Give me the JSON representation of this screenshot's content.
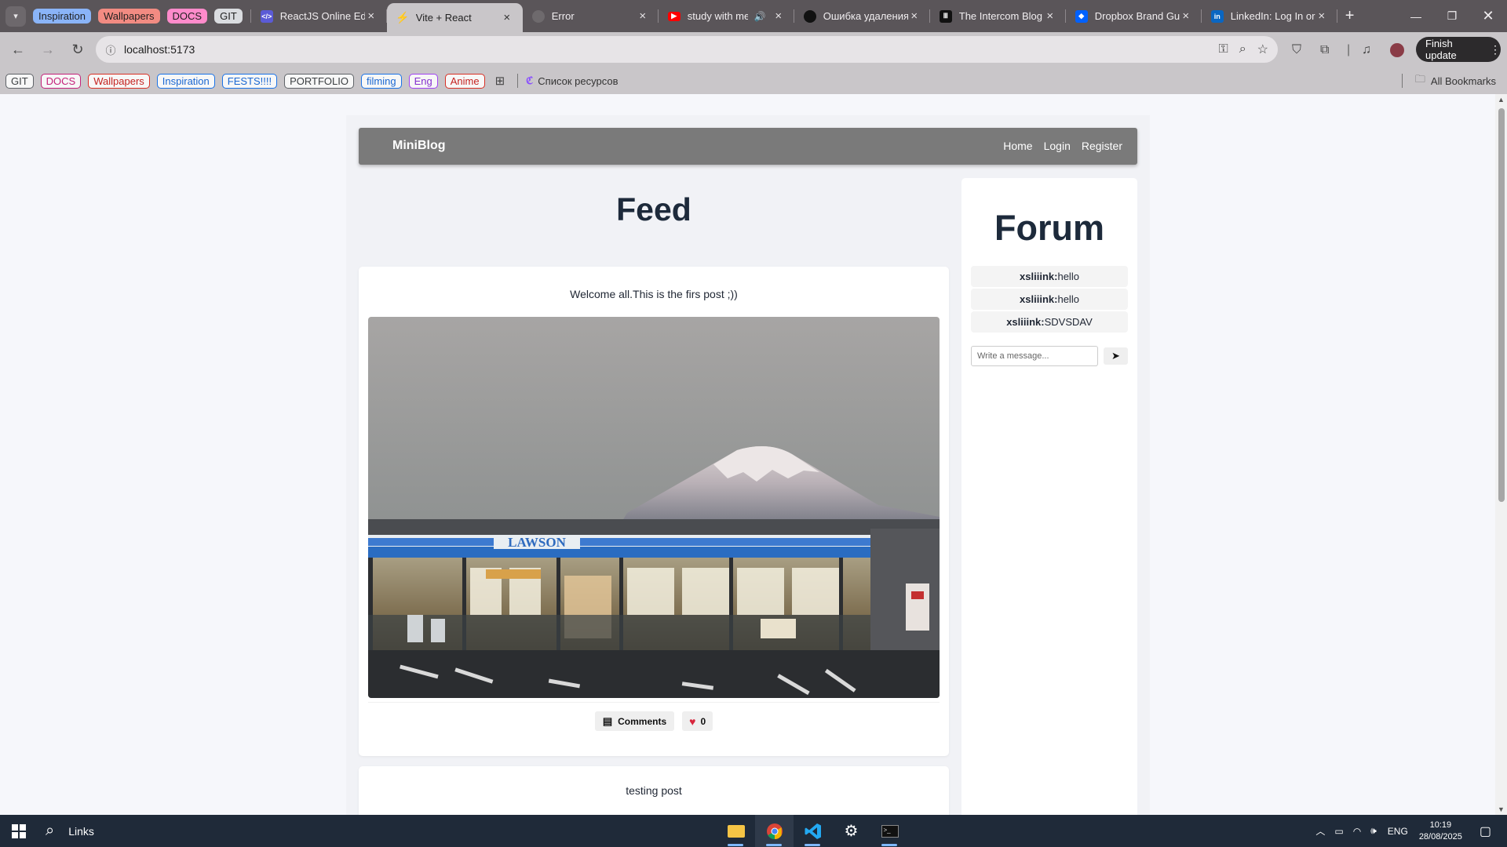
{
  "browser": {
    "tab_groups": [
      {
        "label": "Inspiration",
        "color": "#8ab4f8"
      },
      {
        "label": "Wallpapers",
        "color": "#f28b82"
      },
      {
        "label": "DOCS",
        "color": "#ff8bcb"
      },
      {
        "label": "GIT",
        "color": "#dadce0"
      }
    ],
    "tabs": [
      {
        "title": "ReactJS Online Editor",
        "icon": "code-icon",
        "color": "#5b5bd6",
        "active": false
      },
      {
        "title": "Vite + React",
        "icon": "vite-icon",
        "color": "#b36bff",
        "active": true
      },
      {
        "title": "Error",
        "icon": "globe-icon",
        "color": "#7a7a7a",
        "active": false
      },
      {
        "title": "study with me live",
        "icon": "youtube-icon",
        "color": "#ff0000",
        "active": false,
        "audio": true
      },
      {
        "title": "Ошибка удаления",
        "icon": "github-icon",
        "color": "#111111",
        "active": false
      },
      {
        "title": "The Intercom Blog",
        "icon": "intercom-icon",
        "color": "#1f1f1f",
        "active": false
      },
      {
        "title": "Dropbox Brand Guide",
        "icon": "dropbox-icon",
        "color": "#0061fe",
        "active": false
      },
      {
        "title": "LinkedIn: Log In or",
        "icon": "linkedin-icon",
        "color": "#0a66c2",
        "active": false
      }
    ],
    "url": "localhost:5173",
    "finish_update": "Finish update",
    "bookmarks": [
      {
        "label": "GIT",
        "color": "#5f6368"
      },
      {
        "label": "DOCS",
        "color": "#c5217a"
      },
      {
        "label": "Wallpapers",
        "color": "#d93025"
      },
      {
        "label": "Inspiration",
        "color": "#1a73e8"
      },
      {
        "label": "FESTS!!!!",
        "color": "#1a73e8"
      },
      {
        "label": "PORTFOLIO",
        "color": "#5f6368"
      },
      {
        "label": "filming",
        "color": "#1a73e8"
      },
      {
        "label": "Eng",
        "color": "#a142f4"
      },
      {
        "label": "Anime",
        "color": "#d93025"
      }
    ],
    "bookmark_link": "Список ресурсов",
    "all_bookmarks": "All Bookmarks"
  },
  "app": {
    "brand": "MiniBlog",
    "nav": [
      "Home",
      "Login",
      "Register"
    ],
    "feed_title": "Feed",
    "posts": [
      {
        "text": "Welcome all.This is the firs post ;))",
        "comments_label": "Comments",
        "likes": "0"
      },
      {
        "text": "testing post"
      }
    ],
    "forum": {
      "title": "Forum",
      "messages": [
        {
          "user": "xsliiink:",
          "text": "hello"
        },
        {
          "user": "xsliiink:",
          "text": "hello"
        },
        {
          "user": "xsliiink:",
          "text": "SDVSDAV"
        }
      ],
      "input_placeholder": "Write a message..."
    }
  },
  "taskbar": {
    "search_label": "Links",
    "language": "ENG",
    "time": "10:19",
    "date": "28/08/2025"
  },
  "colors": {
    "navbar": "#7a7a7a",
    "heading": "#1d2a3b",
    "like_heart": "#d7263d"
  }
}
